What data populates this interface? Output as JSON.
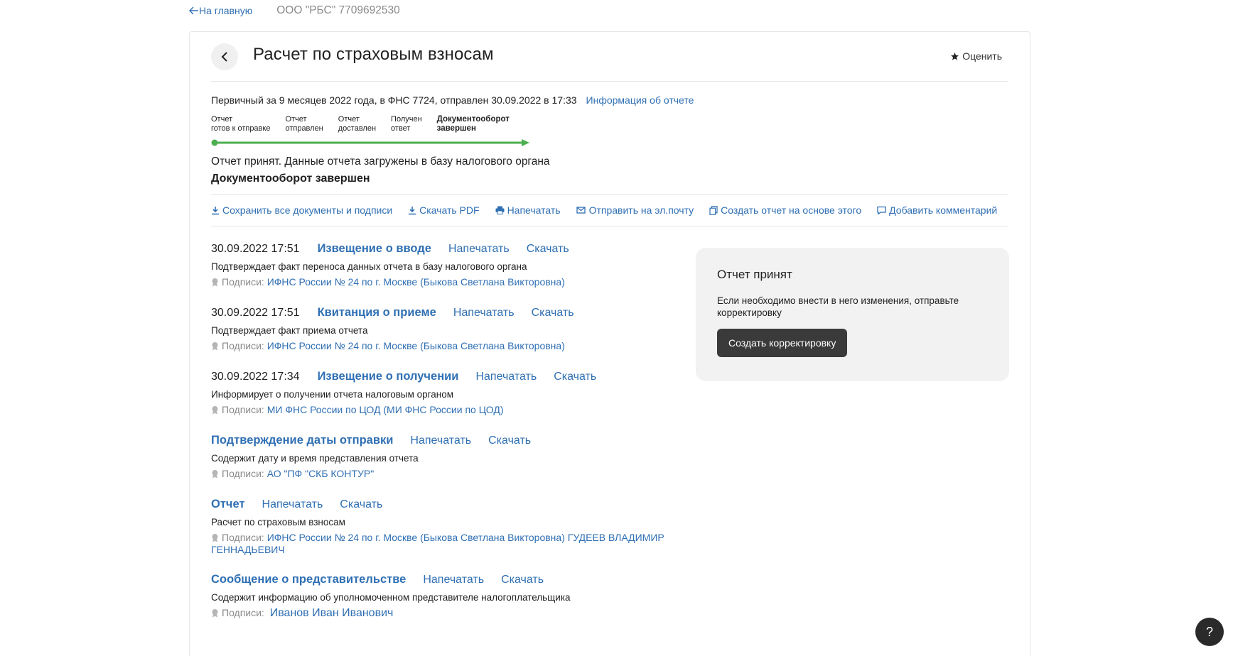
{
  "topbar": {
    "back_label": "На главную",
    "org": "ООО \"РБС\" 7709692530"
  },
  "header": {
    "title": "Расчет по страховым взносам",
    "rate_label": "Оценить"
  },
  "report": {
    "info": "Первичный за 9 месяцев 2022 года, в ФНС 7724, отправлен 30.09.2022 в 17:33",
    "info_link": "Информация об отчете",
    "steps": [
      {
        "line1": "Отчет",
        "line2": "готов к отправке"
      },
      {
        "line1": "Отчет",
        "line2": "отправлен"
      },
      {
        "line1": "Отчет",
        "line2": "доставлен"
      },
      {
        "line1": "Получен",
        "line2": "ответ"
      },
      {
        "line1": "Документооборот",
        "line2": "завершен"
      }
    ],
    "progress": 1.0,
    "progress_color": "#4caf50",
    "status": "Отчет принят. Данные отчета загружены в базу налогового органа",
    "status_bold": "Документооборот завершен"
  },
  "actions": [
    {
      "icon": "download-icon",
      "label": "Сохранить все документы и подписи"
    },
    {
      "icon": "download-icon",
      "label": "Скачать PDF"
    },
    {
      "icon": "printer-icon",
      "label": "Напечатать"
    },
    {
      "icon": "send-email-icon",
      "label": "Отправить на эл.почту"
    },
    {
      "icon": "copy-icon",
      "label": "Создать отчет на основе этого"
    },
    {
      "icon": "comment-icon",
      "label": "Добавить комментарий"
    }
  ],
  "documents": [
    {
      "date": "30.09.2022 17:51",
      "title": "Извещение о вводе",
      "print": "Напечатать",
      "download": "Скачать",
      "desc": "Подтверждает факт переноса данных отчета в базу налогового органа",
      "signs_label": "Подписи:",
      "signs": "ИФНС России № 24 по г. Москве (Быкова Светлана Викторовна)"
    },
    {
      "date": "30.09.2022 17:51",
      "title": "Квитанция о приеме",
      "print": "Напечатать",
      "download": "Скачать",
      "desc": "Подтверждает факт приема отчета",
      "signs_label": "Подписи:",
      "signs": "ИФНС России № 24 по г. Москве (Быкова Светлана Викторовна)"
    },
    {
      "date": "30.09.2022 17:34",
      "title": "Извещение о получении",
      "print": "Напечатать",
      "download": "Скачать",
      "desc": "Информирует о получении отчета налоговым органом",
      "signs_label": "Подписи:",
      "signs": "МИ ФНС России по ЦОД (МИ ФНС России по ЦОД)"
    },
    {
      "date": "",
      "title": "Подтверждение даты отправки",
      "print": "Напечатать",
      "download": "Скачать",
      "desc": "Содержит дату и время представления отчета",
      "signs_label": "Подписи:",
      "signs": "АО \"ПФ \"СКБ КОНТУР\""
    },
    {
      "date": "",
      "title": "Отчет",
      "print": "Напечатать",
      "download": "Скачать",
      "desc": "Расчет по страховым взносам",
      "signs_label": "Подписи:",
      "signs": "ИФНС России № 24 по г. Москве (Быкова Светлана Викторовна) ГУДЕЕВ ВЛАДИМИР ГЕННАДЬЕВИЧ"
    },
    {
      "date": "",
      "title": "Сообщение о представительстве",
      "print": "Напечатать",
      "download": "Скачать",
      "desc": "Содержит информацию об уполномоченном представителе налогоплательщика",
      "signs_label": "Подписи:",
      "signs": "Иванов Иван Иванович"
    }
  ],
  "side": {
    "title": "Отчет принят",
    "text": "Если необходимо внести в него изменения, отправьте корректировку",
    "button": "Создать корректировку"
  },
  "help": {
    "label": "?"
  }
}
